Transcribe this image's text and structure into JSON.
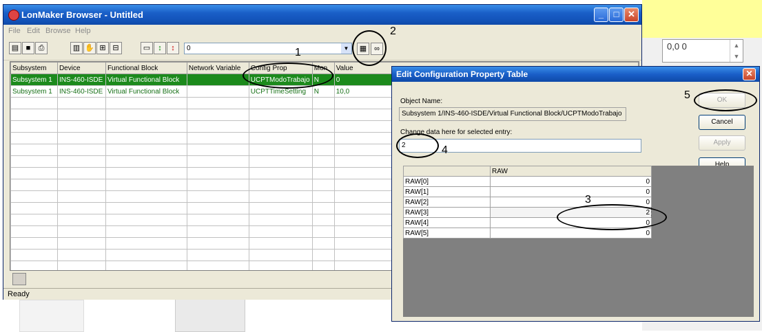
{
  "background_app": {
    "spinner_value": "0,0 0"
  },
  "lonmaker": {
    "title": "LonMaker Browser - Untitled",
    "menu": [
      "File",
      "Edit",
      "Browse",
      "Help"
    ],
    "toolbar_combo_value": "0",
    "columns": [
      "Subsystem",
      "Device",
      "Functional Block",
      "Network Variable",
      "Config Prop",
      "Mon",
      "Value"
    ],
    "rows": [
      [
        "Subsystem 1",
        "INS-460-ISDE",
        "Virtual Functional Block",
        "",
        "UCPTModoTrabajo",
        "N",
        "0"
      ],
      [
        "Subsystem 1",
        "INS-460-ISDE",
        "Virtual Functional Block",
        "",
        "UCPTTimeSetting",
        "N",
        "10,0"
      ]
    ],
    "status": "Ready"
  },
  "dialog": {
    "title": "Edit Configuration Property Table",
    "object_name_label": "Object Name:",
    "object_name_value": "Subsystem 1/INS-460-ISDE/Virtual Functional Block/UCPTModoTrabajo",
    "change_data_label": "Change data here for selected entry:",
    "entry_value": "2",
    "buttons": {
      "ok": "OK",
      "cancel": "Cancel",
      "apply": "Apply",
      "help": "Help"
    },
    "table_header": "RAW",
    "table_rows": [
      [
        "RAW[0]",
        "0"
      ],
      [
        "RAW[1]",
        "0"
      ],
      [
        "RAW[2]",
        "0"
      ],
      [
        "RAW[3]",
        "2"
      ],
      [
        "RAW[4]",
        "0"
      ],
      [
        "RAW[5]",
        "0"
      ]
    ]
  },
  "annotations": [
    "1",
    "2",
    "3",
    "4",
    "5"
  ],
  "colors": {
    "selected_row": "#1c8a1c",
    "title_bar": "#1a5fc8",
    "background_yellow": "#ffff99"
  }
}
